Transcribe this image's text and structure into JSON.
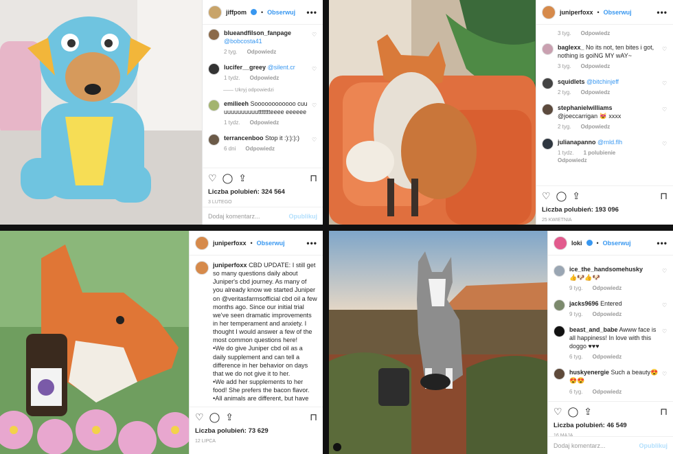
{
  "posts": [
    {
      "username": "jiffpom",
      "follow_label": "Obserwuj",
      "more": "•••",
      "comments": [
        {
          "user": "blueandfilson_fanpage",
          "text": "@bobcosta41",
          "time": "2 tyg.",
          "reply": "Odpowiedz"
        },
        {
          "user": "lucifer__greey",
          "text": "@silent.cr",
          "time": "1 tydz.",
          "reply": "Odpowiedz",
          "hide": "Ukryj odpowiedzi"
        },
        {
          "user": "emilieeh",
          "text": "Soooooooooooo cuuuuuuuuuuuuttttttteeee eeeeee",
          "time": "1 tydz.",
          "reply": "Odpowiedz"
        },
        {
          "user": "terrancenboo",
          "text": "Stop it :):):):)",
          "time": "6 dni",
          "reply": "Odpowiedz"
        }
      ],
      "likes": "Liczba polubień: 324 564",
      "date": "3 LUTEGO",
      "add_comment": "Dodaj komentarz...",
      "publish": "Opublikuj"
    },
    {
      "username": "juniperfoxx",
      "follow_label": "Obserwuj",
      "more": "•••",
      "top_meta": {
        "time": "3 tyg.",
        "reply": "Odpowiedz"
      },
      "comments": [
        {
          "user": "baglexx_",
          "text": "No its not, ten bites i got, nothing is goiNG MY wAY~",
          "time": "3 tyg.",
          "reply": "Odpowiedz"
        },
        {
          "user": "squidlets",
          "text": "@bitchinjeff",
          "time": "2 tyg.",
          "reply": "Odpowiedz"
        },
        {
          "user": "stephanielwilliams",
          "text": "@joeccarrigan 😻 xxxx",
          "time": "2 tyg.",
          "reply": "Odpowiedz"
        },
        {
          "user": "julianapanno",
          "text": "@rnld.flh",
          "time": "1 tydz.",
          "reply": "Odpowiedz",
          "extra": "1 polubienie"
        }
      ],
      "likes": "Liczba polubień: 193 096",
      "date": "25 KWIETNIA",
      "add_comment": "Dodaj komentarz...",
      "publish": "Opublikuj"
    },
    {
      "username": "juniperfoxx",
      "follow_label": "Obserwuj",
      "more": "•••",
      "caption_user": "juniperfoxx",
      "caption": "CBD UPDATE: I still get so many questions daily about Juniper's cbd journey. As many of you already know we started Juniper on @veritasfarmsofficial cbd oil a few months ago. Since our initial trial we've seen dramatic improvements in her temperament and anxiety. I thought I would answer a few of the most common questions here!\n•We do give Juniper cbd oil as a daily supplement and can tell a difference in her behavior on days that we do not give it to her.\n•We add her supplements to her food! She prefers the bacon flavor.\n•All animals are different, but have seen this help decrease her stress levels from over stimulation, which",
      "likes": "Liczba polubień: 73 629",
      "date": "12 LIPCA"
    },
    {
      "username": "loki",
      "follow_label": "Obserwuj",
      "more": "•••",
      "comments": [
        {
          "user": "ice_the_handsomehusky",
          "text": "👍🐶👍🐶",
          "time": "9 tyg.",
          "reply": "Odpowiedz"
        },
        {
          "user": "jacks9696",
          "text": "Entered",
          "time": "9 tyg.",
          "reply": "Odpowiedz"
        },
        {
          "user": "beast_and_babe",
          "text": "Awww face is all happiness! In love with this doggo ♥♥♥",
          "time": "6 tyg.",
          "reply": "Odpowiedz"
        },
        {
          "user": "huskyenergie",
          "text": "Such a beauty😍😍😍",
          "time": "6 tyg.",
          "reply": "Odpowiedz"
        }
      ],
      "likes": "Liczba polubień: 46 549",
      "date": "16 MAJA",
      "add_comment": "Dodaj komentarz...",
      "publish": "Opublikuj"
    }
  ],
  "icons": [
    "heart-icon",
    "comment-icon",
    "share-icon",
    "bookmark-icon"
  ],
  "colors": {
    "link": "#3897f0",
    "muted": "#999999",
    "publish_disabled": "#b2dffc"
  }
}
